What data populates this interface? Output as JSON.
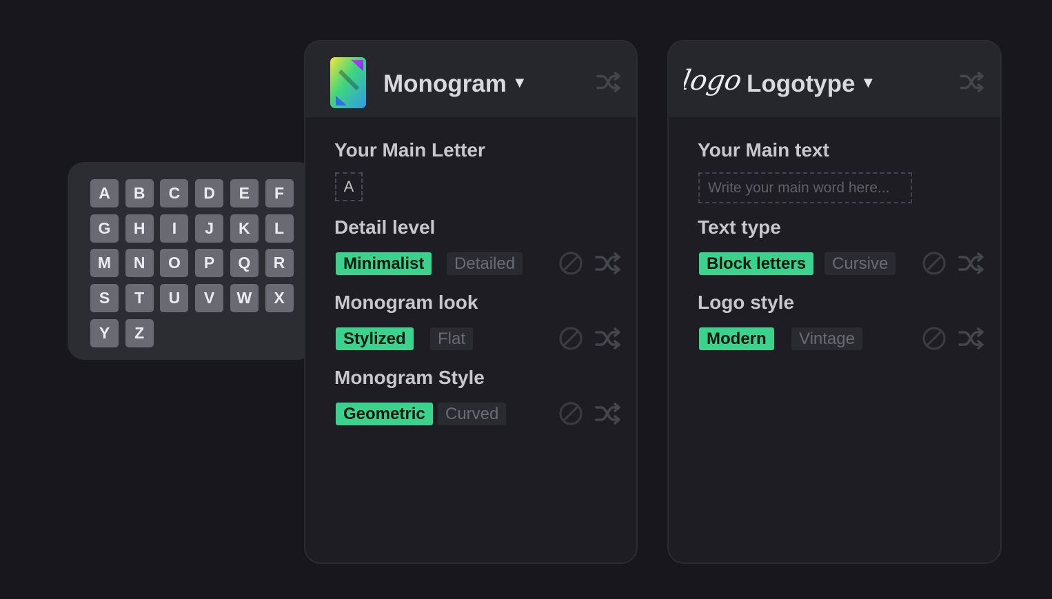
{
  "colors": {
    "background": "#17171d",
    "card": "#1d1d23",
    "card_header": "#26262d",
    "active_chip": "#3ad28c",
    "inactive_chip": "#2a2a31",
    "letter_key": "#6a6a72"
  },
  "letter_picker": {
    "letters": [
      "A",
      "B",
      "C",
      "D",
      "E",
      "F",
      "G",
      "H",
      "I",
      "J",
      "K",
      "L",
      "M",
      "N",
      "O",
      "P",
      "Q",
      "R",
      "S",
      "T",
      "U",
      "V",
      "W",
      "X",
      "Y",
      "Z"
    ]
  },
  "monogram": {
    "title": "Monogram",
    "logo_icon": "gradient-s-logo-icon",
    "main_letter_label": "Your Main Letter",
    "main_letter_value": "A",
    "detail_level": {
      "label": "Detail level",
      "active": "Minimalist",
      "inactive": "Detailed"
    },
    "look": {
      "label": "Monogram look",
      "active": "Stylized",
      "inactive": "Flat"
    },
    "style": {
      "label": "Monogram Style",
      "active": "Geometric",
      "inactive": "Curved"
    }
  },
  "logotype": {
    "title": "Logotype",
    "logo_script": "logo",
    "main_text_label": "Your Main text",
    "main_text_placeholder": "Write your main word here...",
    "text_type": {
      "label": "Text type",
      "active": "Block letters",
      "inactive": "Cursive"
    },
    "logo_style": {
      "label": "Logo style",
      "active": "Modern",
      "inactive": "Vintage"
    }
  }
}
